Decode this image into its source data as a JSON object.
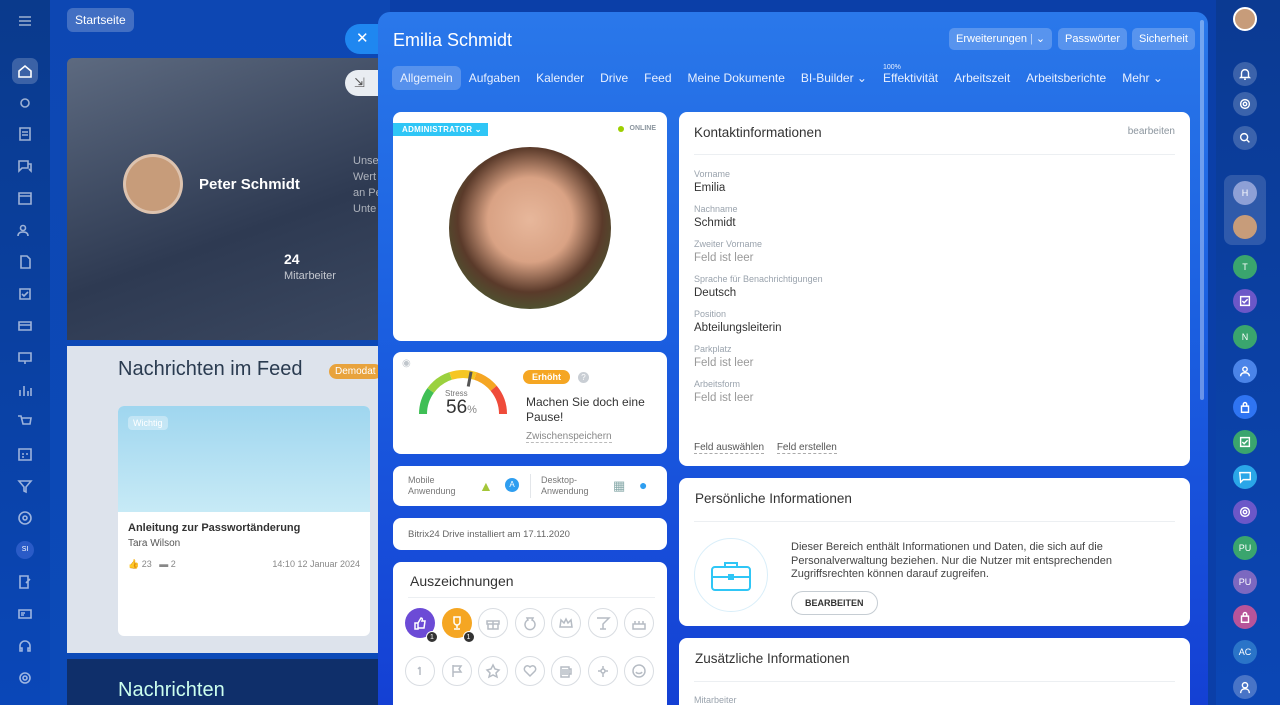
{
  "background": {
    "home_button": "Startseite",
    "profile_name": "Peter Schmidt",
    "employee_count": "24",
    "employee_label": "Mitarbeiter",
    "side_text": [
      "Unse",
      "Wert",
      "an Pe",
      "Unte"
    ],
    "feed_title": "Nachrichten im Feed",
    "demo_badge": "Demodat",
    "post_badge": "Wichtig",
    "post_title": "Anleitung zur Passwortänderung",
    "post_author": "Tara Wilson",
    "post_likes": "23",
    "post_comments": "2",
    "post_date": "14:10 12 Januar 2024",
    "news_title": "Nachrichten"
  },
  "panel": {
    "title": "Emilia Schmidt",
    "buttons": {
      "extensions": "Erweiterungen",
      "passwords": "Passwörter",
      "security": "Sicherheit"
    },
    "tabs": [
      {
        "label": "Allgemein",
        "active": true
      },
      {
        "label": "Aufgaben"
      },
      {
        "label": "Kalender"
      },
      {
        "label": "Drive"
      },
      {
        "label": "Feed"
      },
      {
        "label": "Meine Dokumente"
      },
      {
        "label": "BI-Builder ⌄"
      },
      {
        "label": "Effektivität",
        "sup": "100%"
      },
      {
        "label": "Arbeitszeit"
      },
      {
        "label": "Arbeitsberichte"
      },
      {
        "label": "Mehr ⌄"
      }
    ]
  },
  "profile_card": {
    "role_badge": "ADMINISTRATOR",
    "status": "ONLINE"
  },
  "stress": {
    "label": "Stress",
    "value": "56",
    "unit": "%",
    "level": 0.56,
    "badge": "Erhöht",
    "message": "Machen Sie doch eine Pause!",
    "save_link": "Zwischenspeichern"
  },
  "apps": {
    "mobile_line1": "Mobile",
    "mobile_line2": "Anwendung",
    "desktop_line1": "Desktop-",
    "desktop_line2": "Anwendung"
  },
  "drive_info": "Bitrix24 Drive installiert am 17.11.2020",
  "awards": {
    "title": "Auszeichnungen",
    "row1": [
      "thumbs-up",
      "trophy",
      "gift",
      "money-bag",
      "crown",
      "cocktail",
      "cake"
    ],
    "row2": [
      "number-one",
      "flag",
      "star",
      "heart",
      "beer",
      "flower",
      "smile"
    ],
    "count_thumbs": "1",
    "count_trophy": "1"
  },
  "contact": {
    "title": "Kontaktinformationen",
    "edit": "bearbeiten",
    "fields": [
      {
        "label": "Vorname",
        "value": "Emilia"
      },
      {
        "label": "Nachname",
        "value": "Schmidt"
      },
      {
        "label": "Zweiter Vorname",
        "value": "Feld ist leer"
      },
      {
        "label": "Sprache für Benachrichtigungen",
        "value": "Deutsch"
      },
      {
        "label": "Position",
        "value": "Abteilungsleiterin"
      },
      {
        "label": "Parkplatz",
        "value": "Feld ist leer"
      },
      {
        "label": "Arbeitsform",
        "value": "Feld ist leer"
      }
    ],
    "select_field": "Feld auswählen",
    "create_field": "Feld erstellen"
  },
  "personal": {
    "title": "Persönliche Informationen",
    "text": "Dieser Bereich enthält Informationen und Daten, die sich auf die Personalverwaltung beziehen. Nur die Nutzer mit entsprechenden Zugriffsrechten können darauf zugreifen.",
    "button": "BEARBEITEN"
  },
  "additional": {
    "title": "Zusätzliche Informationen",
    "first_label": "Mitarbeiter"
  },
  "right_nav": {
    "badges": [
      "H",
      "T",
      "N",
      "PU",
      "PU",
      "AC",
      "SI"
    ]
  },
  "colors": {
    "accent": "#2fc6f6",
    "stress_badge": "#f5a623",
    "online": "#9dcf00",
    "panel_top": "#2a78ea",
    "panel_bottom": "#1440d4"
  }
}
